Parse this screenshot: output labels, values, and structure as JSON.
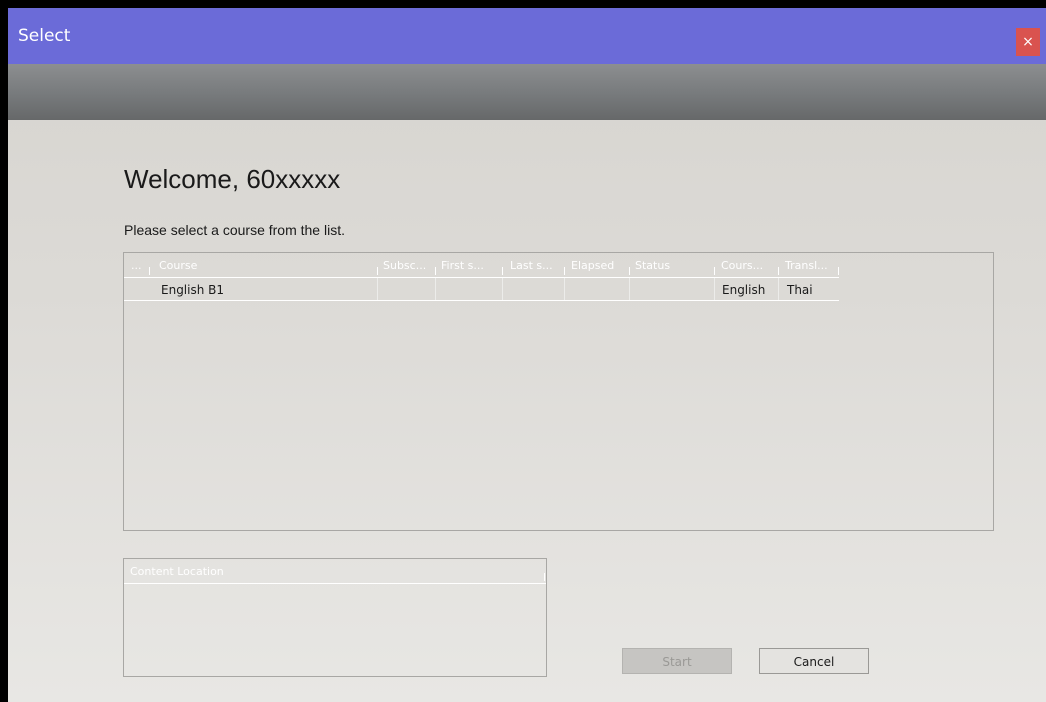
{
  "window": {
    "title": "Select",
    "close_label": "×"
  },
  "main": {
    "welcome": "Welcome, 60xxxxx",
    "instruction": "Please select a course from the list."
  },
  "course_list": {
    "columns": [
      "...",
      "Course",
      "Subsc...",
      "First s...",
      "Last s...",
      "Elapsed",
      "Status",
      "Cours...",
      "Transl..."
    ],
    "rows": [
      {
        "course": "English B1",
        "subscription": "",
        "first_session": "",
        "last_session": "",
        "elapsed": "",
        "status": "",
        "course_language": "English",
        "translation": "Thai"
      }
    ]
  },
  "content_location": {
    "header": "Content Location"
  },
  "buttons": {
    "start": "Start",
    "cancel": "Cancel"
  },
  "colors": {
    "titlebar": "#6b6bd8",
    "close_button": "#d9534f",
    "toolbar": "#777a7c",
    "background": "#dcdad6"
  }
}
